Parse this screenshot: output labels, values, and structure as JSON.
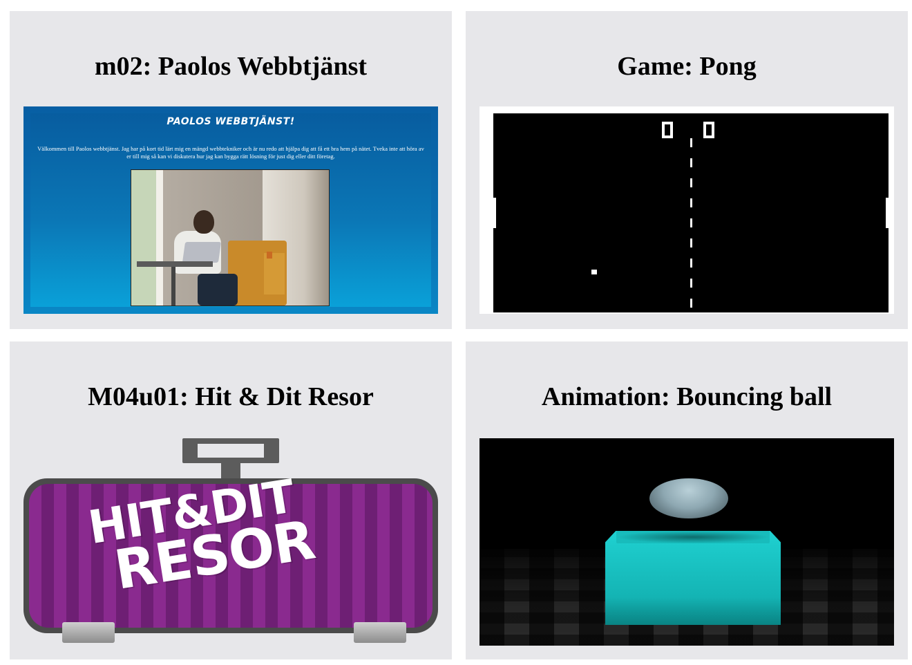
{
  "cards": [
    {
      "title": "m02: Paolos Webbtjänst"
    },
    {
      "title": "Game: Pong"
    },
    {
      "title": "M04u01: Hit & Dit Resor"
    },
    {
      "title": "Animation: Bouncing ball"
    }
  ],
  "paolo_thumb": {
    "heading": "PAOLOS WEBBTJÄNST!",
    "body": "Välkommen till Paolos webbtjänst. Jag har på kort tid lärt mig en mängd webbtekniker och är nu redo att hjälpa dig att få ett bra hem på nätet. Tveka inte att höra av er till mig så kan vi diskutera hur jag kan bygga rätt lösning för just dig eller ditt företag."
  },
  "pong_thumb": {
    "score_left": "0",
    "score_right": "0"
  },
  "hitdit_thumb": {
    "line1": "HIT&DIT",
    "line2": "RESOR"
  },
  "colors": {
    "card_bg": "#e7e7ea",
    "paolo_blue_top": "#075b9e",
    "paolo_blue_bottom": "#0aa4db",
    "hitdit_purple": "#8a2a8f",
    "cube_cyan": "#14b4b4"
  }
}
